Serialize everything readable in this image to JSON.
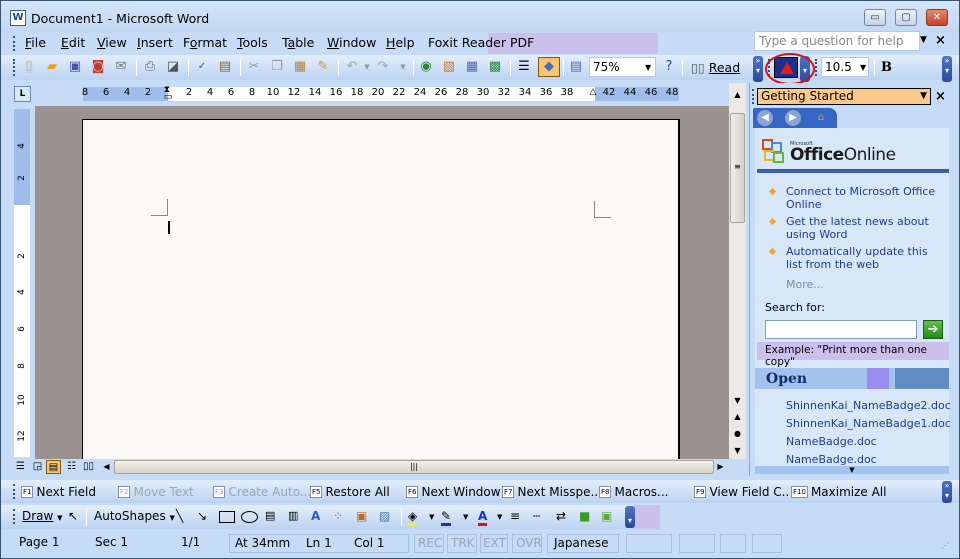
{
  "window": {
    "title": "Document1 - Microsoft Word",
    "app_icon": "W",
    "controls": {
      "minimize": "▭",
      "maximize": "▢",
      "close": "✕"
    }
  },
  "menubar": {
    "items": [
      {
        "label": "File",
        "accel": "F"
      },
      {
        "label": "Edit",
        "accel": "E"
      },
      {
        "label": "View",
        "accel": "V"
      },
      {
        "label": "Insert",
        "accel": "I"
      },
      {
        "label": "Format",
        "accel": "o"
      },
      {
        "label": "Tools",
        "accel": "T"
      },
      {
        "label": "Table",
        "accel": "a"
      },
      {
        "label": "Window",
        "accel": "W"
      },
      {
        "label": "Help",
        "accel": "H"
      },
      {
        "label": "Foxit Reader PDF",
        "accel": ""
      }
    ],
    "help_placeholder": "Type a question for help"
  },
  "toolbar": {
    "icons": [
      "new-icon",
      "open-icon",
      "save-icon",
      "permission-icon",
      "email-icon",
      "print-icon",
      "print-preview-icon",
      "spelling-icon",
      "research-icon",
      "cut-icon",
      "copy-icon",
      "paste-icon",
      "format-painter-icon",
      "undo-icon",
      "redo-icon",
      "hyperlink-icon",
      "tables-borders-icon",
      "insert-table-icon",
      "insert-excel-icon",
      "columns-icon",
      "drawing-icon",
      "document-map-icon"
    ],
    "zoom": "75%",
    "read_label": "Read",
    "font_size": "10.5",
    "bold_label": "B"
  },
  "ruler": {
    "left_numbers": [
      "8",
      "6",
      "4",
      "2"
    ],
    "right_numbers": [
      "2",
      "4",
      "6",
      "8",
      "10",
      "12",
      "14",
      "16",
      "18",
      "20",
      "22",
      "24",
      "26",
      "28",
      "30",
      "32",
      "34",
      "36",
      "38"
    ],
    "margin_numbers": [
      "42",
      "44",
      "46",
      "48"
    ],
    "vertical_top": [
      "4",
      "2"
    ],
    "vertical_main": [
      "2",
      "4",
      "6",
      "8",
      "10",
      "12"
    ]
  },
  "task_pane": {
    "title": "Getting Started",
    "brand_small": "Microsoft",
    "brand_bold": "Office",
    "brand_rest": "Online",
    "links": [
      "Connect to Microsoft Office Online",
      "Get the latest news about using Word",
      "Automatically update this list from the web"
    ],
    "more": "More...",
    "search_label": "Search for:",
    "search_value": "",
    "example": "Example:  \"Print more than one copy\"",
    "open_title": "Open",
    "open_files": [
      "ShinnenKai_NameBadge2.doc",
      "ShinnenKai_NameBadge1.doc",
      "NameBadge.doc",
      "NameBadge.doc"
    ]
  },
  "fkeys": [
    {
      "key": "F1",
      "label": "Next Field",
      "enabled": true
    },
    {
      "key": "F2",
      "label": "Move Text",
      "enabled": false
    },
    {
      "key": "F3",
      "label": "Create Auto...",
      "enabled": false
    },
    {
      "key": "F5",
      "label": "Restore All",
      "enabled": true
    },
    {
      "key": "F6",
      "label": "Next Window",
      "enabled": true
    },
    {
      "key": "F7",
      "label": "Next Misspe...",
      "enabled": true
    },
    {
      "key": "F8",
      "label": "Macros...",
      "enabled": true
    },
    {
      "key": "F9",
      "label": "View Field C..",
      "enabled": true
    },
    {
      "key": "F10",
      "label": "Maximize All",
      "enabled": true
    }
  ],
  "drawbar": {
    "draw_label": "Draw",
    "autoshapes_label": "AutoShapes"
  },
  "status": {
    "page": "Page  1",
    "sec": "Sec  1",
    "pages": "1/1",
    "at": "At  34mm",
    "ln": "Ln  1",
    "col": "Col  1",
    "rec": "REC",
    "trk": "TRK",
    "ext": "EXT",
    "ovr": "OVR",
    "language": "Japanese"
  }
}
